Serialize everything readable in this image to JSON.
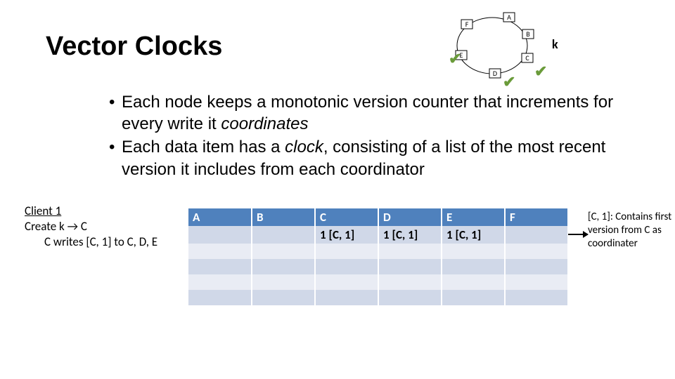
{
  "title": "Vector Clocks",
  "diagram": {
    "nodes": [
      "A",
      "B",
      "C",
      "D",
      "E",
      "F"
    ],
    "k_label": "k",
    "replicas": [
      "C",
      "D",
      "E"
    ]
  },
  "bullets": [
    {
      "pre": "Each node keeps a monotonic version counter that increments for every write it ",
      "em": "coordinates",
      "post": ""
    },
    {
      "pre": "Each data item has a ",
      "em": "clock",
      "post": ", consisting of a list of the most recent version it includes from each coordinator"
    }
  ],
  "ops": {
    "client": "Client 1",
    "line1_a": "Create k ",
    "line1_arrow": "→",
    "line1_b": " C",
    "line2": "C writes [C, 1] to C, D, E"
  },
  "table": {
    "headers": [
      "A",
      "B",
      "C",
      "D",
      "E",
      "F"
    ],
    "rows": [
      [
        "",
        "",
        "1 [C, 1]",
        "1 [C, 1]",
        "1 [C, 1]",
        ""
      ],
      [
        "",
        "",
        "",
        "",
        "",
        ""
      ],
      [
        "",
        "",
        "",
        "",
        "",
        ""
      ],
      [
        "",
        "",
        "",
        "",
        "",
        ""
      ],
      [
        "",
        "",
        "",
        "",
        "",
        ""
      ]
    ]
  },
  "annotation": "[C, 1]: Contains first version from C as coordinater",
  "chart_data": {
    "type": "table",
    "headers": [
      "A",
      "B",
      "C",
      "D",
      "E",
      "F"
    ],
    "rows": [
      {
        "A": "",
        "B": "",
        "C": "1 [C, 1]",
        "D": "1 [C, 1]",
        "E": "1 [C, 1]",
        "F": ""
      }
    ]
  }
}
